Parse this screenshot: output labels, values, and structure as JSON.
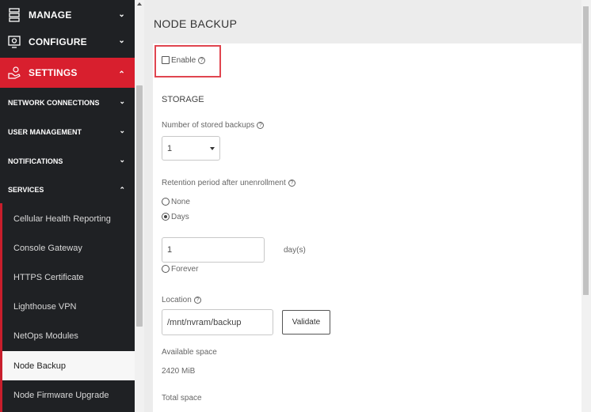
{
  "sidebar": {
    "top_items": [
      {
        "label": "MANAGE",
        "icon": "server-stack-icon"
      },
      {
        "label": "CONFIGURE",
        "icon": "gear-icon"
      },
      {
        "label": "SETTINGS",
        "icon": "settings-hand-icon"
      }
    ],
    "sub_items": [
      {
        "label": "NETWORK CONNECTIONS"
      },
      {
        "label": "USER MANAGEMENT"
      },
      {
        "label": "NOTIFICATIONS"
      },
      {
        "label": "SERVICES"
      }
    ],
    "services": [
      "Cellular Health Reporting",
      "Console Gateway",
      "HTTPS Certificate",
      "Lighthouse VPN",
      "NetOps Modules",
      "Node Backup",
      "Node Firmware Upgrade"
    ],
    "chevron_down": "⌄",
    "chevron_up": "⌃"
  },
  "main": {
    "title": "NODE BACKUP",
    "enable_label": "Enable",
    "storage_heading": "STORAGE",
    "stored_backups_label": "Number of stored backups",
    "stored_backups_value": "1",
    "retention_label": "Retention period after unenrollment",
    "opt_none": "None",
    "opt_days": "Days",
    "days_value": "1",
    "days_unit": "day(s)",
    "opt_forever": "Forever",
    "location_label": "Location",
    "location_value": "/mnt/nvram/backup",
    "validate_label": "Validate",
    "available_label": "Available space",
    "available_value": "2420 MiB",
    "total_label": "Total space"
  },
  "colors": {
    "accent": "#d81f2e",
    "sidebar_bg": "#1f2124"
  }
}
